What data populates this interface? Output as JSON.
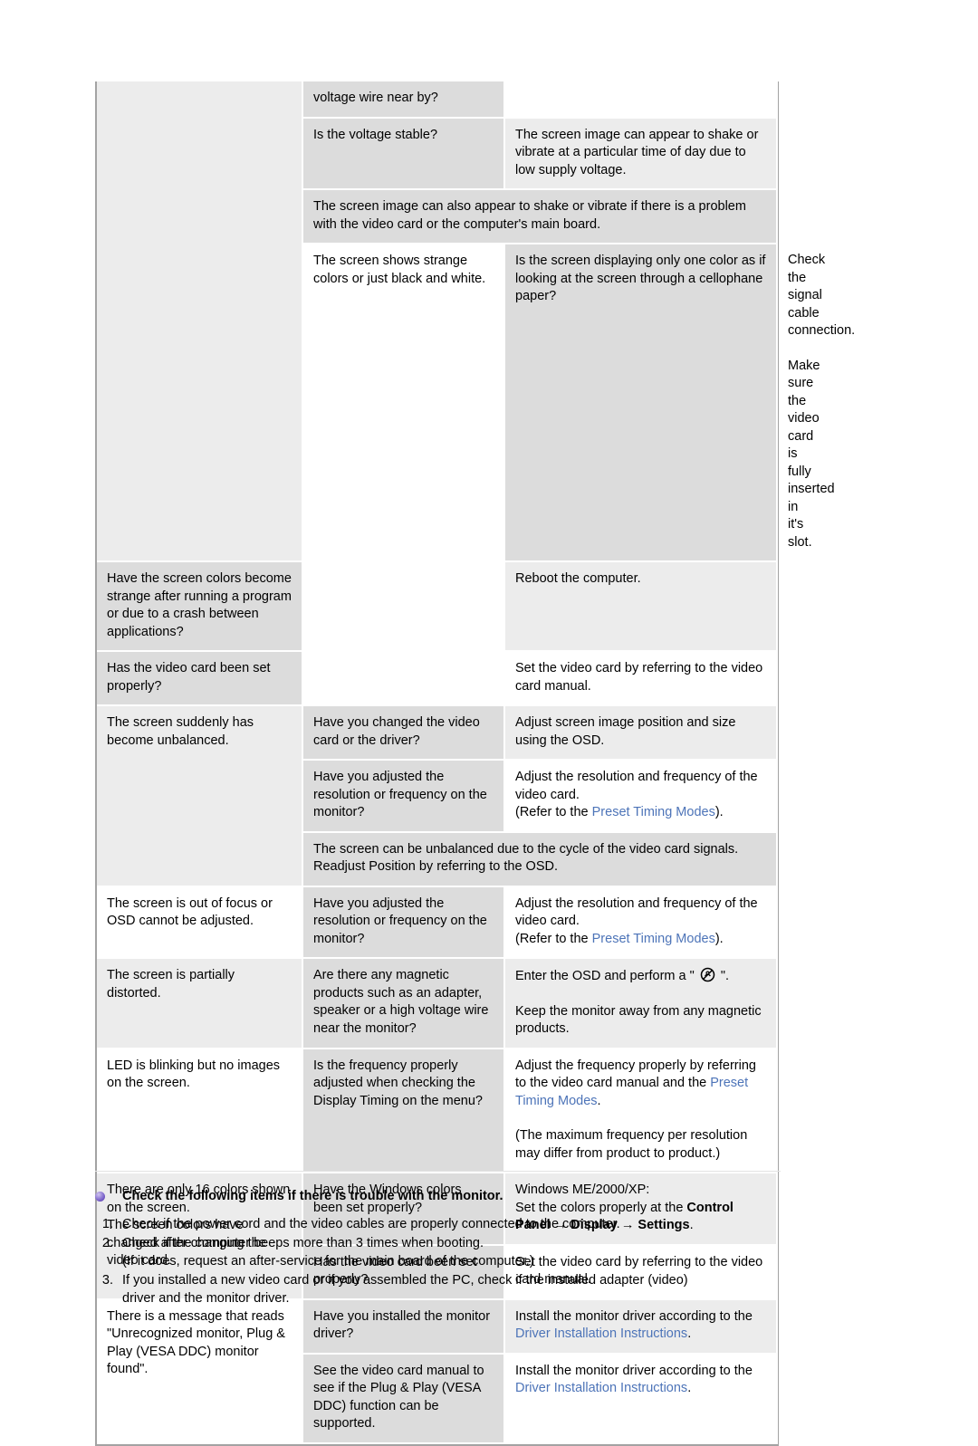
{
  "table": {
    "rows": [
      {
        "symptom": "",
        "symptom_shade": "a",
        "symptom_rowspan": 4,
        "cells": [
          {
            "question": "voltage wire near by?",
            "q_shade": "b",
            "answer": "",
            "a_shade": "w"
          }
        ]
      },
      {
        "cells": [
          {
            "question": "Is the voltage stable?",
            "q_shade": "b",
            "answer": "The screen image can appear to shake or vibrate at a particular time of day due to low supply voltage.",
            "a_shade": "c"
          }
        ]
      },
      {
        "span_note": "The screen image can also appear to shake or vibrate if there is a problem with the video card or the computer's main board.",
        "span_shade": "sp"
      },
      {
        "symptom": "The screen shows strange colors or just black and white.",
        "symptom_shade": "white",
        "symptom_rowspan": 3,
        "cells": [
          {
            "question": "Is the screen displaying only one color as if looking at the screen through a cellophane paper?",
            "q_shade": "b",
            "answer_lines": [
              "Check the signal cable connection.",
              "",
              "Make sure the video card is fully inserted in it's slot."
            ],
            "a_shade": "w"
          }
        ]
      },
      {
        "cells": [
          {
            "question": "Have the screen colors become strange after running a program or due to a crash between applications?",
            "q_shade": "b",
            "answer": "Reboot the computer.",
            "a_shade": "c"
          }
        ]
      },
      {
        "cells": [
          {
            "question": "Has the video card been set properly?",
            "q_shade": "b",
            "answer": "Set the video card by referring to the video card manual.",
            "a_shade": "w"
          }
        ]
      },
      {
        "symptom": "The screen suddenly has become unbalanced.",
        "symptom_shade": "a",
        "symptom_rowspan": 3,
        "cells": [
          {
            "question": "Have you changed the video card or the driver?",
            "q_shade": "b",
            "answer": "Adjust screen image position and size using the OSD.",
            "a_shade": "c"
          }
        ]
      },
      {
        "cells": [
          {
            "question": "Have you adjusted the resolution or frequency on the monitor?",
            "q_shade": "b",
            "answer_prefix": "Adjust the resolution and frequency of the video card.",
            "answer_refer_pre": "(Refer to the ",
            "answer_link": "Preset Timing Modes",
            "answer_refer_post": ").",
            "a_shade": "w"
          }
        ]
      },
      {
        "span_note": "The screen can be unbalanced due to the cycle of the video card signals. Readjust Position by referring to the OSD.",
        "span_shade": "sp"
      },
      {
        "symptom": "The screen is out of focus or OSD cannot be adjusted.",
        "symptom_shade": "white",
        "symptom_rowspan": 1,
        "cells": [
          {
            "question": "Have you adjusted the resolution or frequency on the monitor?",
            "q_shade": "b",
            "answer_prefix": "Adjust the resolution and frequency of the video card.",
            "answer_refer_pre": "(Refer to the ",
            "answer_link": "Preset Timing Modes",
            "answer_refer_post": ").",
            "a_shade": "w"
          }
        ]
      },
      {
        "symptom": "The screen is partially distorted.",
        "symptom_shade": "a",
        "symptom_rowspan": 1,
        "cells": [
          {
            "question": "Are there any magnetic products such as an adapter, speaker or a high voltage wire near the monitor?",
            "q_shade": "b",
            "answer_osd_pre": "Enter the OSD and perform a \" ",
            "answer_osd_icon": "degauss-icon",
            "answer_osd_post": " \".",
            "answer_osd_second": "Keep the monitor away from any magnetic products.",
            "a_shade": "c"
          }
        ]
      },
      {
        "symptom": "LED is blinking but no images on the screen.",
        "symptom_shade": "white",
        "symptom_rowspan": 1,
        "cells": [
          {
            "question": "Is the frequency properly adjusted when checking the Display Timing on the menu?",
            "q_shade": "b",
            "answer_freq_pre": "Adjust the frequency properly by referring to the video card manual and the ",
            "answer_link": "Preset Timing Modes",
            "answer_freq_post": ".",
            "answer_freq_second": "(The maximum frequency per resolution may differ from product to product.)",
            "a_shade": "w"
          }
        ]
      },
      {
        "symptom": "There are only 16 colors shown on the screen.\nThe screen colors have changed after changing the video card.",
        "symptom_shade": "a",
        "symptom_rowspan": 2,
        "cells": [
          {
            "question": "Have the Windows colors been set properly?",
            "q_shade": "b",
            "answer_win_line1": "Windows ME/2000/XP:",
            "answer_win_line2_pre": "Set the colors properly at the ",
            "answer_win_b1": "Control Panel",
            "answer_win_arrow": "→",
            "answer_win_b2": "Display",
            "answer_win_b3": "Settings",
            "answer_win_post": ".",
            "a_shade": "c"
          }
        ]
      },
      {
        "cells": [
          {
            "question": "Has the video card been set properly?",
            "q_shade": "b",
            "answer": "Set the video card by referring to the video card manual.",
            "a_shade": "w"
          }
        ]
      },
      {
        "symptom": "There is a message that reads \"Unrecognized monitor, Plug & Play (VESA DDC) monitor found\".",
        "symptom_shade": "white",
        "symptom_rowspan": 2,
        "cells": [
          {
            "question": "Have you installed the monitor driver?",
            "q_shade": "b",
            "answer_drv_pre": "Install the monitor driver according to the ",
            "answer_link": "Driver Installation Instructions",
            "answer_drv_post": ".",
            "a_shade": "c"
          }
        ]
      },
      {
        "cells": [
          {
            "question": "See the video card manual to see if the Plug & Play (VESA DDC) function can be supported.",
            "q_shade": "b",
            "answer_drv_pre": "Install the monitor driver according to the ",
            "answer_link": "Driver Installation Instructions",
            "answer_drv_post": ".",
            "a_shade": "w"
          }
        ]
      }
    ]
  },
  "notes": {
    "heading": "Check the following items if there is trouble with the monitor.",
    "items": [
      {
        "num": "1.",
        "text": "Check if the power cord and the video cables are properly connected to the computer.",
        "sub": ""
      },
      {
        "num": "2.",
        "text": "Check if the computer beeps more than 3 times when booting.",
        "sub": "(If it does, request an after-service for the main board of the computer.)"
      },
      {
        "num": "3.",
        "text": "If you installed a new video card or if you assembled the PC, check if the installed adapter (video)",
        "sub": "driver and the monitor driver."
      }
    ]
  },
  "colors": {
    "link": "#4d74b8",
    "shade_light": "#ececec",
    "shade_medium": "#dcdcdc",
    "border": "#a3a3a3",
    "bullet": "#6a4fbd"
  }
}
